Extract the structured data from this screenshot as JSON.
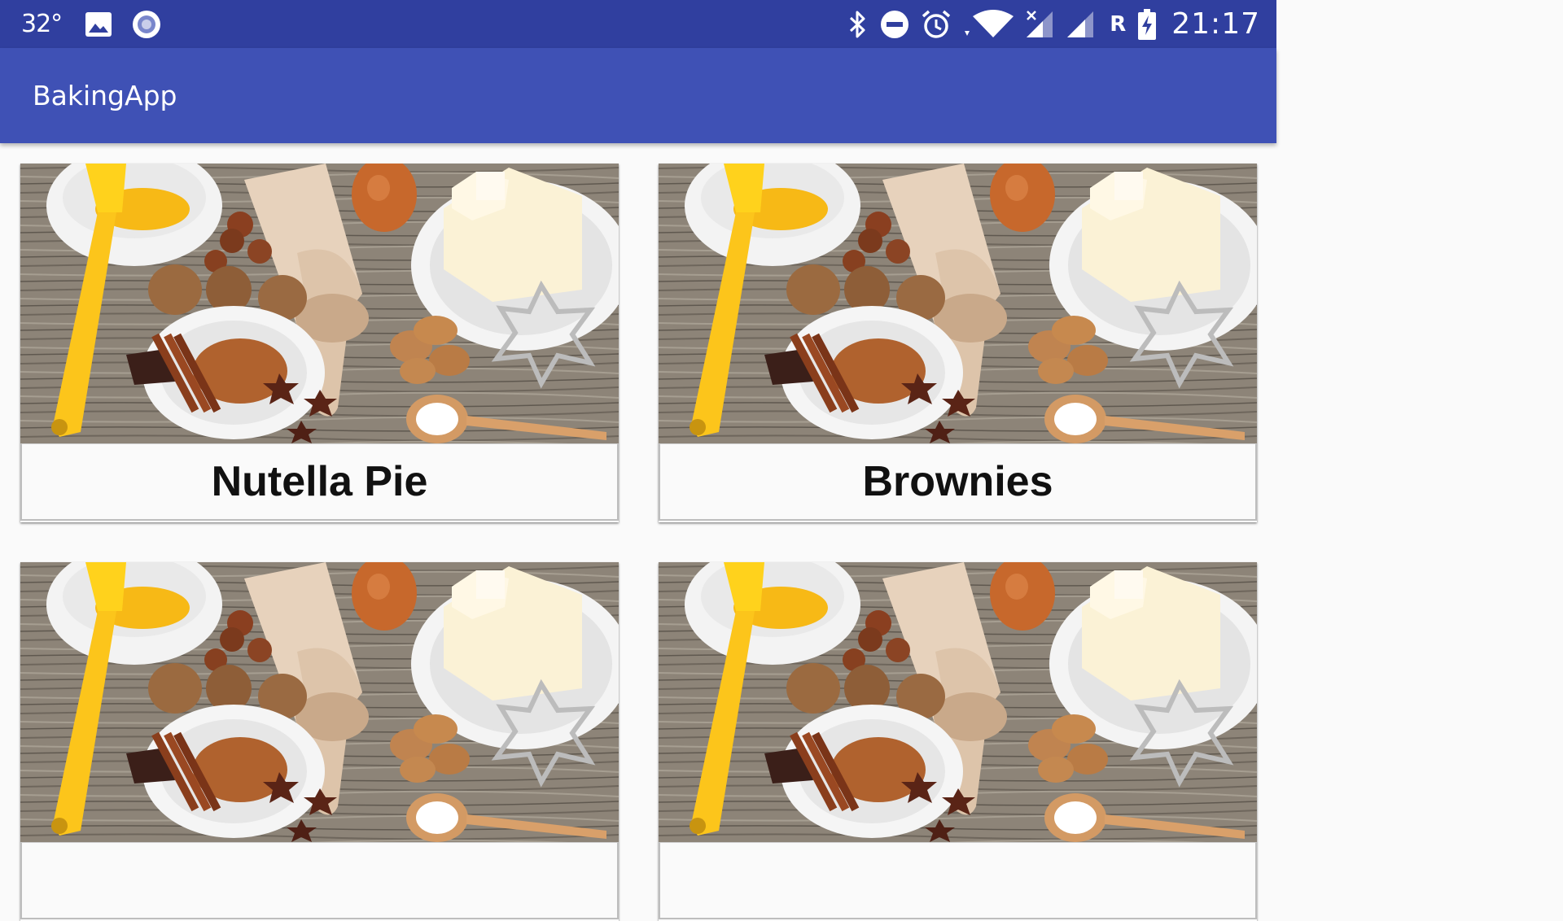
{
  "status_bar": {
    "temperature": "32°",
    "time": "21:17",
    "roaming": "R",
    "icons": [
      "image-icon",
      "record-icon",
      "bluetooth-icon",
      "do-not-disturb-icon",
      "alarm-icon",
      "wifi-icon",
      "mobile-signal-icon",
      "signal-icon",
      "battery-charging-icon"
    ]
  },
  "app_bar": {
    "title": "BakingApp"
  },
  "recipes": [
    {
      "name": "Nutella Pie"
    },
    {
      "name": "Brownies"
    },
    {
      "name": ""
    },
    {
      "name": ""
    }
  ],
  "colors": {
    "status_bar": "#303f9f",
    "app_bar": "#3f51b5",
    "background": "#fafafa"
  }
}
